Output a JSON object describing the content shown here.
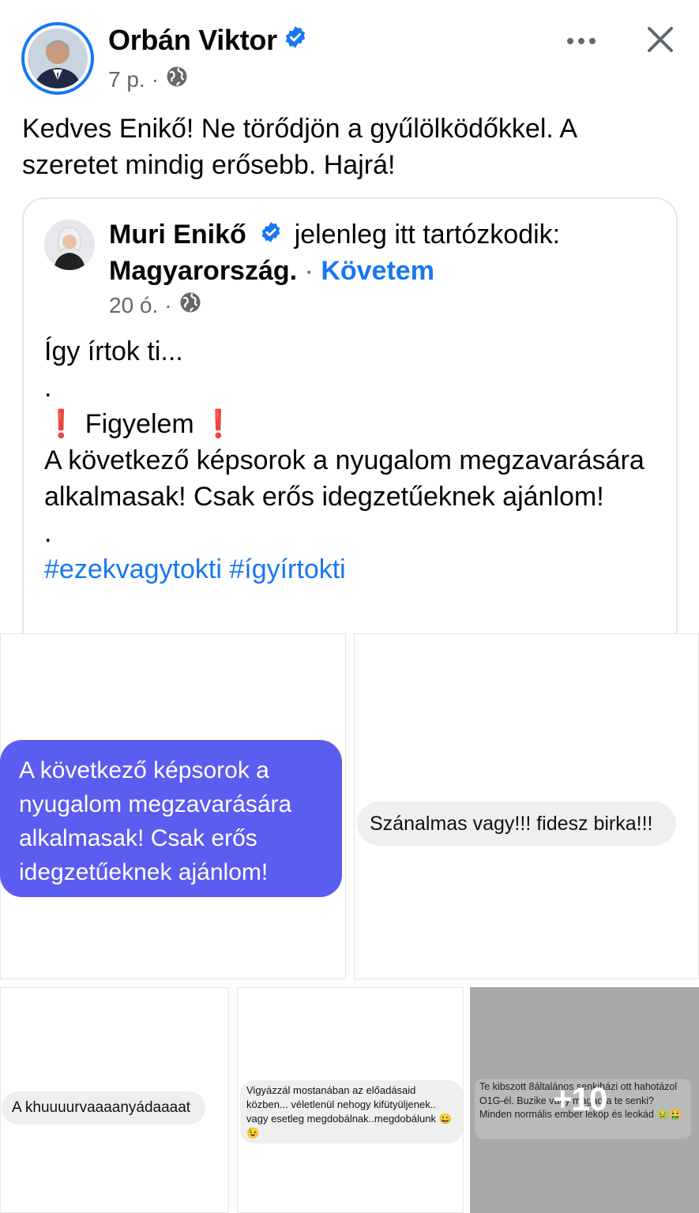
{
  "post": {
    "author": "Orbán Viktor",
    "time": "7 p.",
    "separator": "·",
    "text": "Kedves Enikő! Ne törődjön a gyűlölködőkkel. A szeretet mindig erősebb. Hajrá!"
  },
  "shared": {
    "author": "Muri Enikő",
    "location_prefix": "jelenleg itt tartózkodik:",
    "location": "Magyarország.",
    "follow_sep": "·",
    "follow_label": "Követem",
    "time": "20 ó.",
    "separator": "·",
    "line1": "Így írtok ti...",
    "dot": ".",
    "excl": "❗",
    "warning": "Figyelem",
    "body": "A következő képsorok a nyugalom megzavarására alkalmasak! Csak erős idegzetűeknek ajánlom!",
    "hashtags": "#ezekvagytokti #ígyírtokti"
  },
  "gallery": {
    "bubble_main": "A következő képsorok a nyugalom megzavarására alkalmasak! Csak erős idegzetűeknek ajánlom!",
    "comment1": "Szánalmas vagy!!! fidesz birka!!!",
    "comment2": "A khuuuurvaaaanyádaaaat",
    "comment3": "Vigyázzál mostanában az előadásaid közben... véletlenül nehogy kifütyüljenek.. vagy esetleg megdobálnak..megdobálunk 😀😉",
    "comment4": "Te kibszott 8általános senkiházi ott hahotázol O1G-él. Buzike vagy magadra te senki? Minden normális ember leköp és leokád 🤢🤮",
    "more_count": "+10"
  },
  "colors": {
    "accent": "#1877f2",
    "purple_bubble": "#5b5cf0",
    "muted": "#65676b"
  },
  "icons": [
    "verified-badge-icon",
    "globe-icon",
    "more-icon",
    "close-icon"
  ]
}
